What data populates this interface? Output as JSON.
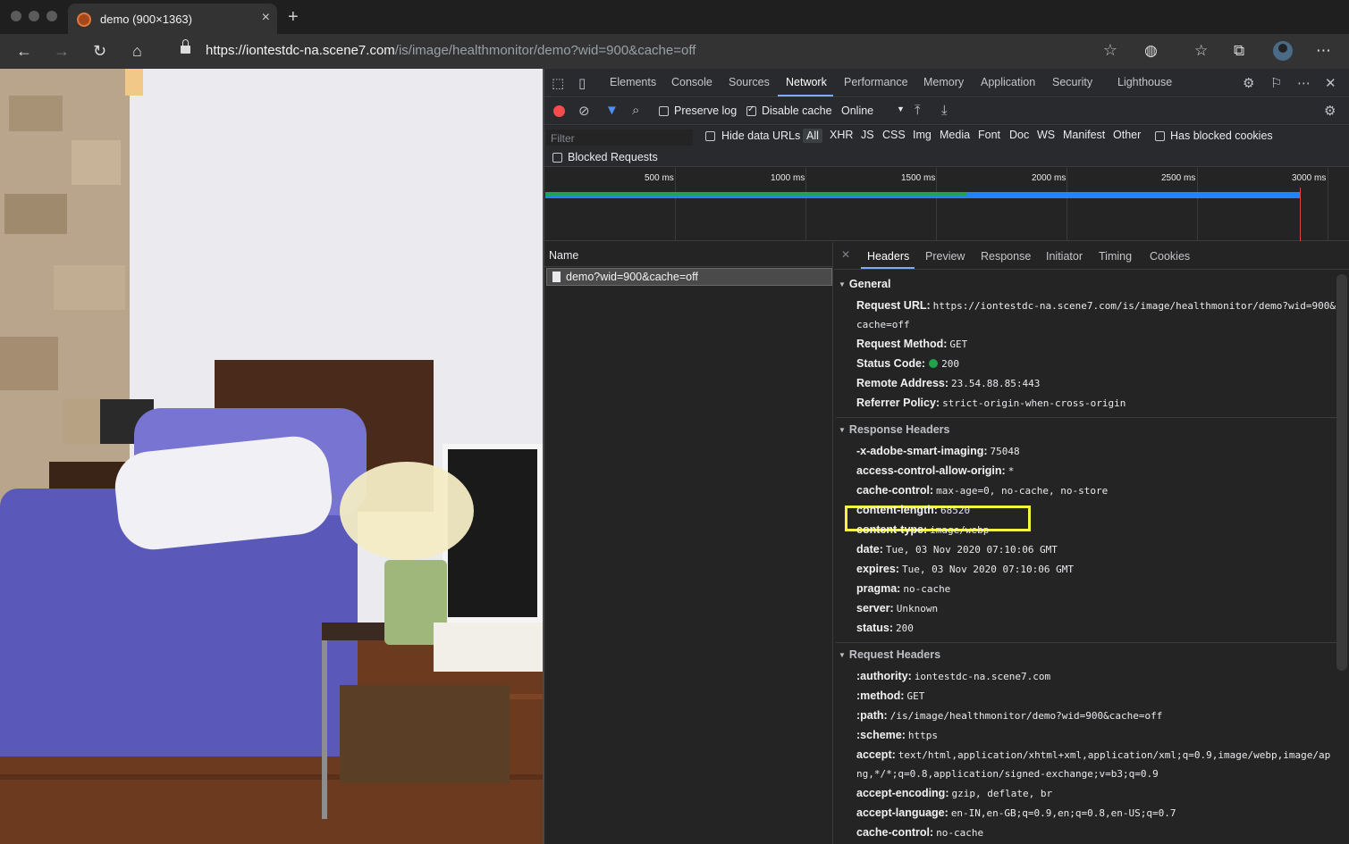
{
  "browser": {
    "tab_title": "demo (900×1363)",
    "url_host": "https://iontestdc-na.scene7.com",
    "url_path": "/is/image/healthmonitor/demo?wid=900&cache=off",
    "icons": [
      "back-icon",
      "forward-icon",
      "reload-icon",
      "home-icon",
      "lock-icon",
      "star-icon",
      "extension-icon",
      "favorites-icon",
      "collections-icon",
      "avatar",
      "more-icon"
    ]
  },
  "devtools": {
    "tabs": [
      "Elements",
      "Console",
      "Sources",
      "Network",
      "Performance",
      "Memory",
      "Application",
      "Security",
      "Lighthouse"
    ],
    "active_tab": "Network",
    "toolbar": {
      "preserve_log": "Preserve log",
      "disable_cache": "Disable cache",
      "throttle": "Online"
    },
    "filter": {
      "placeholder": "Filter",
      "hide_data_urls": "Hide data URLs",
      "types": [
        "All",
        "XHR",
        "JS",
        "CSS",
        "Img",
        "Media",
        "Font",
        "Doc",
        "WS",
        "Manifest",
        "Other"
      ],
      "has_blocked_cookies": "Has blocked cookies",
      "blocked_requests": "Blocked Requests"
    },
    "overview": {
      "ticks": [
        "500 ms",
        "1000 ms",
        "1500 ms",
        "2000 ms",
        "2500 ms",
        "3000 ms"
      ]
    },
    "requests": {
      "name_header": "Name",
      "rows": [
        "demo?wid=900&cache=off"
      ]
    },
    "detail": {
      "tabs": [
        "Headers",
        "Preview",
        "Response",
        "Initiator",
        "Timing",
        "Cookies"
      ],
      "active_tab": "Headers",
      "general_title": "General",
      "general": [
        {
          "k": "Request URL:",
          "v": "https://iontestdc-na.scene7.com/is/image/healthmonitor/demo?wid=900&",
          "cont": "cache=off"
        },
        {
          "k": "Request Method:",
          "v": "GET"
        },
        {
          "k": "Status Code:",
          "v": "200"
        },
        {
          "k": "Remote Address:",
          "v": "23.54.88.85:443"
        },
        {
          "k": "Referrer Policy:",
          "v": "strict-origin-when-cross-origin"
        }
      ],
      "response_title": "Response Headers",
      "response": [
        {
          "k": "-x-adobe-smart-imaging:",
          "v": "75048"
        },
        {
          "k": "access-control-allow-origin:",
          "v": "*"
        },
        {
          "k": "cache-control:",
          "v": "max-age=0, no-cache, no-store"
        },
        {
          "k": "content-length:",
          "v": "68520"
        },
        {
          "k": "content-type:",
          "v": "image/webp"
        },
        {
          "k": "date:",
          "v": "Tue, 03 Nov 2020 07:10:06 GMT"
        },
        {
          "k": "expires:",
          "v": "Tue, 03 Nov 2020 07:10:06 GMT"
        },
        {
          "k": "pragma:",
          "v": "no-cache"
        },
        {
          "k": "server:",
          "v": "Unknown"
        },
        {
          "k": "status:",
          "v": "200"
        }
      ],
      "request_title": "Request Headers",
      "request": [
        {
          "k": ":authority:",
          "v": "iontestdc-na.scene7.com"
        },
        {
          "k": ":method:",
          "v": "GET"
        },
        {
          "k": ":path:",
          "v": "/is/image/healthmonitor/demo?wid=900&cache=off"
        },
        {
          "k": ":scheme:",
          "v": "https"
        },
        {
          "k": "accept:",
          "v": "text/html,application/xhtml+xml,application/xml;q=0.9,image/webp,image/ap",
          "cont": "ng,*/*;q=0.8,application/signed-exchange;v=b3;q=0.9"
        },
        {
          "k": "accept-encoding:",
          "v": "gzip, deflate, br"
        },
        {
          "k": "accept-language:",
          "v": "en-IN,en-GB;q=0.9,en;q=0.8,en-US;q=0.7"
        },
        {
          "k": "cache-control:",
          "v": "no-cache"
        }
      ]
    }
  },
  "colors": {
    "highlight": "#f6f23e",
    "status_ok": "#1ea446",
    "record": "#f24c4c",
    "accent_tab": "#7cacf8"
  }
}
